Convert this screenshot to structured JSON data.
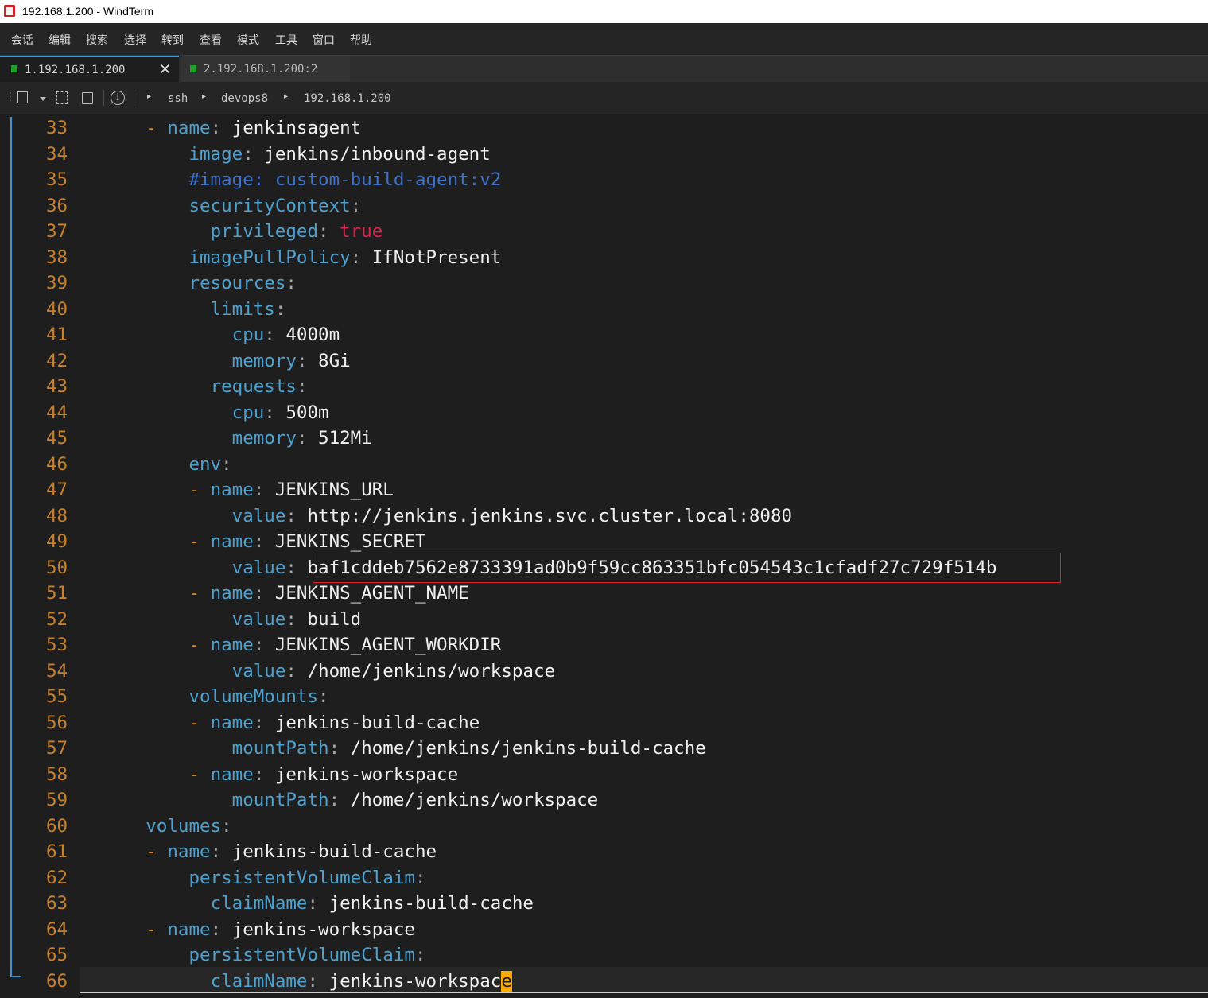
{
  "window": {
    "title": "192.168.1.200 - WindTerm",
    "icon": "windterm-app-icon"
  },
  "menu": [
    "会话",
    "编辑",
    "搜索",
    "选择",
    "转到",
    "查看",
    "模式",
    "工具",
    "窗口",
    "帮助"
  ],
  "tabs": [
    {
      "label": "1.192.168.1.200",
      "active": true,
      "close": "✕"
    },
    {
      "label": "2.192.168.1.200:2",
      "active": false
    }
  ],
  "toolbar": {
    "icons": [
      "new-session-icon",
      "dropdown-icon",
      "duplicate-session-icon",
      "copy-session-icon",
      "info-icon"
    ],
    "breadcrumb": [
      "ssh",
      "devops8",
      "192.168.1.200"
    ]
  },
  "editor": {
    "lines": [
      {
        "n": "33",
        "indent": "        ",
        "dash": true,
        "key": "name",
        "sep": ":",
        "value": " jenkinsagent",
        "vtype": "v"
      },
      {
        "n": "34",
        "indent": "          ",
        "dash": false,
        "key": "image",
        "sep": ":",
        "value": " jenkins/inbound-agent",
        "vtype": "v"
      },
      {
        "n": "35",
        "indent": "          ",
        "dash": false,
        "key": "#image: custom-build-agent:v2",
        "sep": "",
        "value": "",
        "vtype": "c",
        "comment": true
      },
      {
        "n": "36",
        "indent": "          ",
        "dash": false,
        "key": "securityContext",
        "sep": ":",
        "value": "",
        "vtype": "v"
      },
      {
        "n": "37",
        "indent": "            ",
        "dash": false,
        "key": "privileged",
        "sep": ":",
        "value": " true",
        "vtype": "t"
      },
      {
        "n": "38",
        "indent": "          ",
        "dash": false,
        "key": "imagePullPolicy",
        "sep": ":",
        "value": " IfNotPresent",
        "vtype": "v"
      },
      {
        "n": "39",
        "indent": "          ",
        "dash": false,
        "key": "resources",
        "sep": ":",
        "value": "",
        "vtype": "v"
      },
      {
        "n": "40",
        "indent": "            ",
        "dash": false,
        "key": "limits",
        "sep": ":",
        "value": "",
        "vtype": "v"
      },
      {
        "n": "41",
        "indent": "              ",
        "dash": false,
        "key": "cpu",
        "sep": ":",
        "value": " 4000m",
        "vtype": "v"
      },
      {
        "n": "42",
        "indent": "              ",
        "dash": false,
        "key": "memory",
        "sep": ":",
        "value": " 8Gi",
        "vtype": "v"
      },
      {
        "n": "43",
        "indent": "            ",
        "dash": false,
        "key": "requests",
        "sep": ":",
        "value": "",
        "vtype": "v"
      },
      {
        "n": "44",
        "indent": "              ",
        "dash": false,
        "key": "cpu",
        "sep": ":",
        "value": " 500m",
        "vtype": "v"
      },
      {
        "n": "45",
        "indent": "              ",
        "dash": false,
        "key": "memory",
        "sep": ":",
        "value": " 512Mi",
        "vtype": "v"
      },
      {
        "n": "46",
        "indent": "          ",
        "dash": false,
        "key": "env",
        "sep": ":",
        "value": "",
        "vtype": "v"
      },
      {
        "n": "47",
        "indent": "            ",
        "dash": true,
        "key": "name",
        "sep": ":",
        "value": " JENKINS_URL",
        "vtype": "v"
      },
      {
        "n": "48",
        "indent": "              ",
        "dash": false,
        "key": "value",
        "sep": ":",
        "value": " http://jenkins.jenkins.svc.cluster.local:8080",
        "vtype": "v"
      },
      {
        "n": "49",
        "indent": "            ",
        "dash": true,
        "key": "name",
        "sep": ":",
        "value": " JENKINS_SECRET",
        "vtype": "v"
      },
      {
        "n": "50",
        "indent": "              ",
        "dash": false,
        "key": "value",
        "sep": ":",
        "value": " baf1cddeb7562e8733391ad0b9f59cc863351bfc054543c1cfadf27c729f514b",
        "vtype": "v",
        "highlight": true
      },
      {
        "n": "51",
        "indent": "            ",
        "dash": true,
        "key": "name",
        "sep": ":",
        "value": " JENKINS_AGENT_NAME",
        "vtype": "v"
      },
      {
        "n": "52",
        "indent": "              ",
        "dash": false,
        "key": "value",
        "sep": ":",
        "value": " build",
        "vtype": "v"
      },
      {
        "n": "53",
        "indent": "            ",
        "dash": true,
        "key": "name",
        "sep": ":",
        "value": " JENKINS_AGENT_WORKDIR",
        "vtype": "v"
      },
      {
        "n": "54",
        "indent": "              ",
        "dash": false,
        "key": "value",
        "sep": ":",
        "value": " /home/jenkins/workspace",
        "vtype": "v"
      },
      {
        "n": "55",
        "indent": "          ",
        "dash": false,
        "key": "volumeMounts",
        "sep": ":",
        "value": "",
        "vtype": "v"
      },
      {
        "n": "56",
        "indent": "            ",
        "dash": true,
        "key": "name",
        "sep": ":",
        "value": " jenkins-build-cache",
        "vtype": "v"
      },
      {
        "n": "57",
        "indent": "              ",
        "dash": false,
        "key": "mountPath",
        "sep": ":",
        "value": " /home/jenkins/jenkins-build-cache",
        "vtype": "v"
      },
      {
        "n": "58",
        "indent": "            ",
        "dash": true,
        "key": "name",
        "sep": ":",
        "value": " jenkins-workspace",
        "vtype": "v"
      },
      {
        "n": "59",
        "indent": "              ",
        "dash": false,
        "key": "mountPath",
        "sep": ":",
        "value": " /home/jenkins/workspace",
        "vtype": "v"
      },
      {
        "n": "60",
        "indent": "      ",
        "dash": false,
        "key": "volumes",
        "sep": ":",
        "value": "",
        "vtype": "v"
      },
      {
        "n": "61",
        "indent": "        ",
        "dash": true,
        "key": "name",
        "sep": ":",
        "value": " jenkins-build-cache",
        "vtype": "v"
      },
      {
        "n": "62",
        "indent": "          ",
        "dash": false,
        "key": "persistentVolumeClaim",
        "sep": ":",
        "value": "",
        "vtype": "v"
      },
      {
        "n": "63",
        "indent": "            ",
        "dash": false,
        "key": "claimName",
        "sep": ":",
        "value": " jenkins-build-cache",
        "vtype": "v"
      },
      {
        "n": "64",
        "indent": "        ",
        "dash": true,
        "key": "name",
        "sep": ":",
        "value": " jenkins-workspace",
        "vtype": "v"
      },
      {
        "n": "65",
        "indent": "          ",
        "dash": false,
        "key": "persistentVolumeClaim",
        "sep": ":",
        "value": "",
        "vtype": "v"
      },
      {
        "n": "66",
        "indent": "            ",
        "dash": false,
        "key": "claimName",
        "sep": ":",
        "value": " jenkins-workspac",
        "vtype": "v",
        "cursor_char": "e",
        "current": true
      }
    ]
  },
  "colors": {
    "background": "#1e1e1e",
    "line_number": "#c8802a",
    "key": "#4ea1cf",
    "value": "#f0f0f0",
    "comment": "#3f73c9",
    "boolean": "#d8244a",
    "highlight_border": "#e02020",
    "cursor": "#ffaa00",
    "tab_indicator": "#22a02e"
  }
}
